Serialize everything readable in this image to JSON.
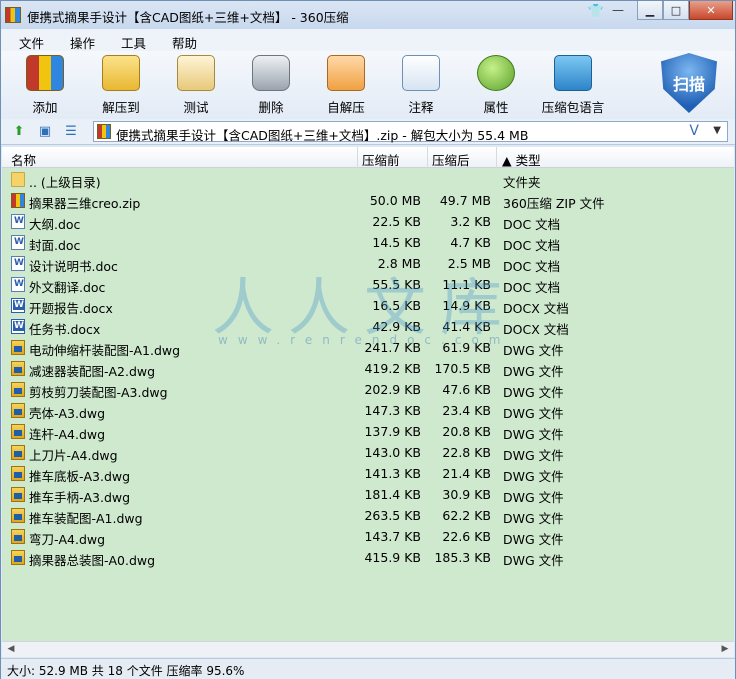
{
  "window": {
    "title": "便携式摘果手设计【含CAD图纸+三维+文档】 - 360压缩",
    "controls": {
      "skin": "👕",
      "dash": "—",
      "minimize": "▁",
      "maximize": "□",
      "close": "✕"
    }
  },
  "menu": [
    "文件",
    "操作",
    "工具",
    "帮助"
  ],
  "toolbar": [
    {
      "label": "添加",
      "icon": "add-archive-icon"
    },
    {
      "label": "解压到",
      "icon": "extract-to-icon"
    },
    {
      "label": "测试",
      "icon": "test-icon"
    },
    {
      "label": "删除",
      "icon": "delete-icon"
    },
    {
      "label": "自解压",
      "icon": "self-extract-icon"
    },
    {
      "label": "注释",
      "icon": "comment-icon"
    },
    {
      "label": "属性",
      "icon": "info-icon"
    },
    {
      "label": "压缩包语言",
      "icon": "encoding-icon"
    }
  ],
  "scan": {
    "label": "扫描"
  },
  "address": {
    "text": "便携式摘果手设计【含CAD图纸+三维+文档】.zip - 解包大小为 55.4 MB",
    "v_button": "V",
    "dropdown": "▼"
  },
  "columns": {
    "name": "名称",
    "packed": "压缩前",
    "unpacked": "压缩后",
    "type": "▲ 类型"
  },
  "files": [
    {
      "name": ".. (上级目录)",
      "packed": "",
      "unpacked": "",
      "type": "文件夹",
      "kind": "folder"
    },
    {
      "name": "摘果器三维creo.zip",
      "packed": "50.0 MB",
      "unpacked": "49.7 MB",
      "type": "360压缩 ZIP 文件",
      "kind": "zip"
    },
    {
      "name": "大纲.doc",
      "packed": "22.5 KB",
      "unpacked": "3.2 KB",
      "type": "DOC 文档",
      "kind": "doc"
    },
    {
      "name": "封面.doc",
      "packed": "14.5 KB",
      "unpacked": "4.7 KB",
      "type": "DOC 文档",
      "kind": "doc"
    },
    {
      "name": "设计说明书.doc",
      "packed": "2.8 MB",
      "unpacked": "2.5 MB",
      "type": "DOC 文档",
      "kind": "doc"
    },
    {
      "name": "外文翻译.doc",
      "packed": "55.5 KB",
      "unpacked": "11.1 KB",
      "type": "DOC 文档",
      "kind": "doc"
    },
    {
      "name": "开题报告.docx",
      "packed": "16.5 KB",
      "unpacked": "14.9 KB",
      "type": "DOCX 文档",
      "kind": "docx"
    },
    {
      "name": "任务书.docx",
      "packed": "42.9 KB",
      "unpacked": "41.4 KB",
      "type": "DOCX 文档",
      "kind": "docx"
    },
    {
      "name": "电动伸缩杆装配图-A1.dwg",
      "packed": "241.7 KB",
      "unpacked": "61.9 KB",
      "type": "DWG 文件",
      "kind": "dwg"
    },
    {
      "name": "减速器装配图-A2.dwg",
      "packed": "419.2 KB",
      "unpacked": "170.5 KB",
      "type": "DWG 文件",
      "kind": "dwg"
    },
    {
      "name": "剪枝剪刀装配图-A3.dwg",
      "packed": "202.9 KB",
      "unpacked": "47.6 KB",
      "type": "DWG 文件",
      "kind": "dwg"
    },
    {
      "name": "壳体-A3.dwg",
      "packed": "147.3 KB",
      "unpacked": "23.4 KB",
      "type": "DWG 文件",
      "kind": "dwg"
    },
    {
      "name": "连杆-A4.dwg",
      "packed": "137.9 KB",
      "unpacked": "20.8 KB",
      "type": "DWG 文件",
      "kind": "dwg"
    },
    {
      "name": "上刀片-A4.dwg",
      "packed": "143.0 KB",
      "unpacked": "22.8 KB",
      "type": "DWG 文件",
      "kind": "dwg"
    },
    {
      "name": "推车底板-A3.dwg",
      "packed": "141.3 KB",
      "unpacked": "21.4 KB",
      "type": "DWG 文件",
      "kind": "dwg"
    },
    {
      "name": "推车手柄-A3.dwg",
      "packed": "181.4 KB",
      "unpacked": "30.9 KB",
      "type": "DWG 文件",
      "kind": "dwg"
    },
    {
      "name": "推车装配图-A1.dwg",
      "packed": "263.5 KB",
      "unpacked": "62.2 KB",
      "type": "DWG 文件",
      "kind": "dwg"
    },
    {
      "name": "弯刀-A4.dwg",
      "packed": "143.7 KB",
      "unpacked": "22.6 KB",
      "type": "DWG 文件",
      "kind": "dwg"
    },
    {
      "name": "摘果器总装图-A0.dwg",
      "packed": "415.9 KB",
      "unpacked": "185.3 KB",
      "type": "DWG 文件",
      "kind": "dwg"
    }
  ],
  "watermark": {
    "logo": "人人文库",
    "url": "www.renrendoc.com"
  },
  "status": "大小: 52.9 MB 共 18 个文件 压缩率 95.6%",
  "colors": {
    "list_bg": "#cfe9cf",
    "accent": "#1f5fb4"
  }
}
